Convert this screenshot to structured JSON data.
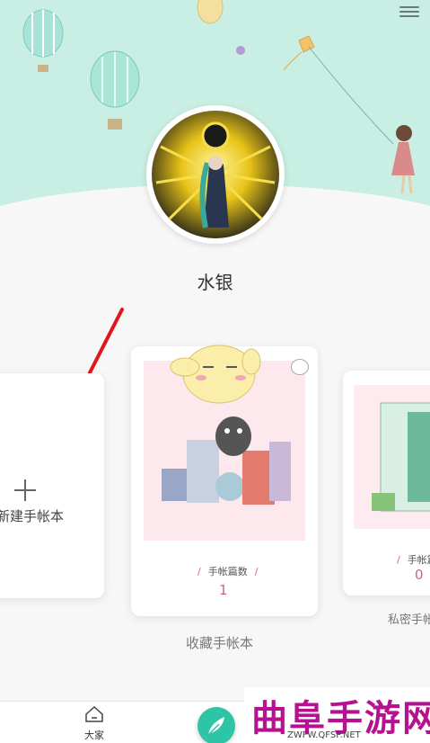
{
  "profile": {
    "username": "水银"
  },
  "cards": {
    "new_notebook": {
      "label": "新建手帐本"
    },
    "favorites": {
      "stat_label": "手帐篇数",
      "stat_value": "1",
      "title": "收藏手帐本"
    },
    "private": {
      "stat_label": "手帐篇数",
      "stat_value": "0",
      "title": "私密手帐本"
    }
  },
  "bottom_nav": {
    "home_label": "大家"
  },
  "watermark": {
    "title": "曲阜手游网",
    "url": "ZWFW.QFSP.NET"
  },
  "colors": {
    "header_bg": "#c9efe4",
    "accent": "#2ec5a6",
    "stat_pink": "#c9687e",
    "arrow_red": "#e0161c",
    "watermark_purple": "#b5128f"
  },
  "icons": {
    "menu": "hamburger-menu-icon",
    "home": "home-icon",
    "write": "feather-quill-icon",
    "add": "plus-icon",
    "cover_badge": "shirt-icon"
  }
}
